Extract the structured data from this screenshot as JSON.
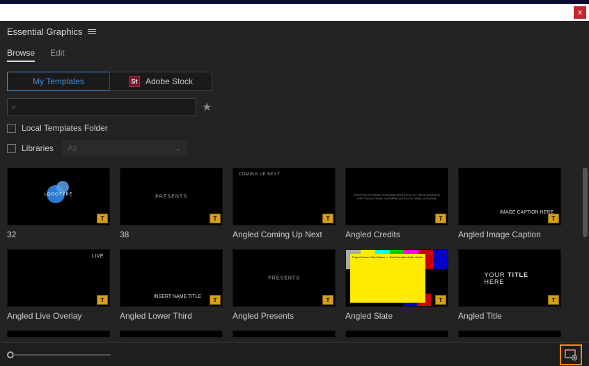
{
  "header": {
    "title": "Essential Graphics"
  },
  "tabs": {
    "browse": "Browse",
    "edit": "Edit"
  },
  "sources": {
    "my_templates": "My Templates",
    "adobe_stock": "Adobe Stock",
    "stock_badge": "St"
  },
  "search": {
    "placeholder": ""
  },
  "filters": {
    "local_folder": "Local Templates Folder",
    "libraries": "Libraries",
    "lib_dropdown": "All"
  },
  "thumbs": [
    {
      "label": "32"
    },
    {
      "label": "38"
    },
    {
      "label": "Angled Coming Up Next"
    },
    {
      "label": "Angled Credits"
    },
    {
      "label": "Angled Image Caption"
    },
    {
      "label": "Angled Live Overlay"
    },
    {
      "label": "Angled Lower Third"
    },
    {
      "label": "Angled Presents"
    },
    {
      "label": "Angled Slate"
    },
    {
      "label": "Angled Title"
    }
  ],
  "preview_text": {
    "logotype": "LOGOTYPE",
    "presents": "PRESENTS",
    "coming_up": "COMING UP NEXT",
    "credits": "DIRECTED BY NAME SURNAME\nPRODUCED BY NAME SURNAME\nWRITTEN BY NAME SURNAME\nEDITED BY NAME SURNAME",
    "caption": "IMAGE CAPTION HERE",
    "live": "LIVE",
    "lower_third": "INSERT NAME TITLE",
    "title1": "YOUR ",
    "title2": "TITLE ",
    "title3": "HERE",
    "slate": "Project Name\nClient Name\n—\nDate\nDuration\nAudio\nNotes"
  },
  "badge_text": "T",
  "close_text": "x"
}
